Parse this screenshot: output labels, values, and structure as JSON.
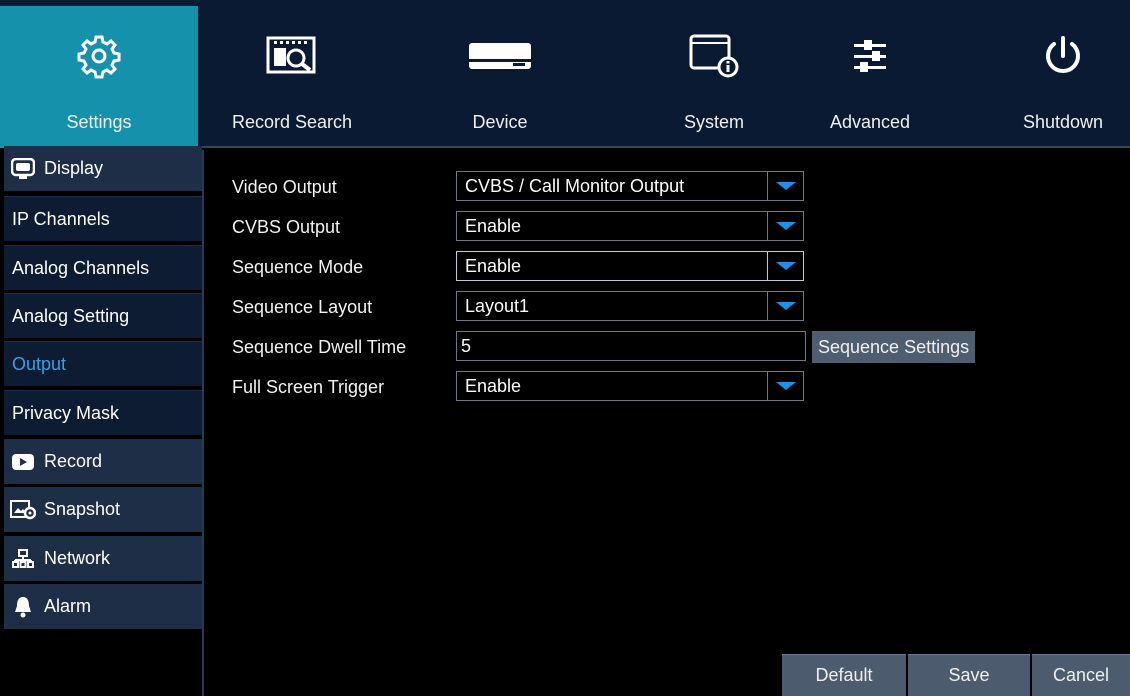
{
  "nav": {
    "items": [
      {
        "label": "Settings",
        "icon": "gear-icon"
      },
      {
        "label": "Record Search",
        "icon": "film-search-icon"
      },
      {
        "label": "Device",
        "icon": "hard-drive-icon"
      },
      {
        "label": "System",
        "icon": "window-info-icon"
      },
      {
        "label": "Advanced",
        "icon": "sliders-icon"
      },
      {
        "label": "Shutdown",
        "icon": "power-icon"
      }
    ],
    "active_index": 0,
    "active_color": "#1591ab"
  },
  "sidebar": {
    "items": [
      {
        "label": "Display",
        "type": "group",
        "icon": "monitor-icon"
      },
      {
        "label": "IP Channels",
        "type": "sub"
      },
      {
        "label": "Analog Channels",
        "type": "sub"
      },
      {
        "label": "Analog Setting",
        "type": "sub"
      },
      {
        "label": "Output",
        "type": "sub",
        "selected": true
      },
      {
        "label": "Privacy Mask",
        "type": "sub"
      },
      {
        "label": "Record",
        "type": "group",
        "icon": "play-icon"
      },
      {
        "label": "Snapshot",
        "type": "group",
        "icon": "snapshot-icon"
      },
      {
        "label": "Network",
        "type": "group",
        "icon": "network-icon"
      },
      {
        "label": "Alarm",
        "type": "group",
        "icon": "bell-icon"
      }
    ],
    "selected_color": "#3aa0e6"
  },
  "form": {
    "video_output": {
      "label": "Video Output",
      "value": "CVBS / Call Monitor Output"
    },
    "cvbs_output": {
      "label": "CVBS Output",
      "value": "Enable"
    },
    "sequence_mode": {
      "label": "Sequence Mode",
      "value": "Enable"
    },
    "sequence_layout": {
      "label": "Sequence Layout",
      "value": "Layout1"
    },
    "sequence_dwell_time": {
      "label": "Sequence Dwell Time",
      "value": "5"
    },
    "sequence_settings_label": "Sequence Settings",
    "full_screen_trigger": {
      "label": "Full Screen Trigger",
      "value": "Enable"
    }
  },
  "footer": {
    "default_label": "Default",
    "save_label": "Save",
    "cancel_label": "Cancel"
  }
}
